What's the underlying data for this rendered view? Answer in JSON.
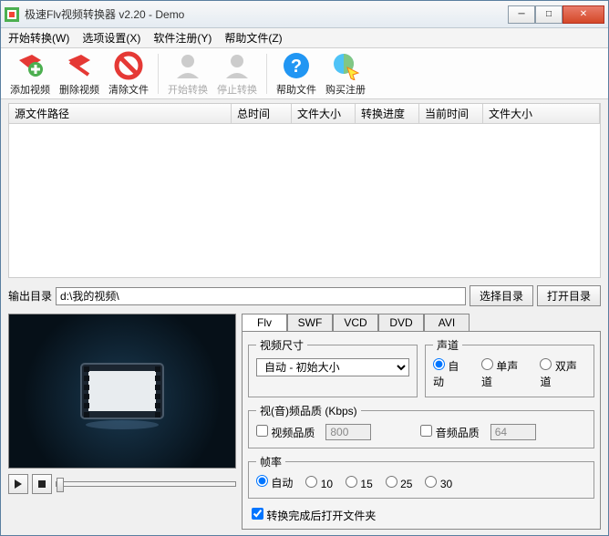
{
  "window": {
    "title": "极速Flv视频转换器 v2.20 - Demo"
  },
  "menu": {
    "start": "开始转换(W)",
    "options": "选项设置(X)",
    "register": "软件注册(Y)",
    "help": "帮助文件(Z)"
  },
  "toolbar": {
    "add": "添加视频",
    "del": "删除视频",
    "clear": "清除文件",
    "begin": "开始转换",
    "stop": "停止转换",
    "help": "帮助文件",
    "buy": "购买注册"
  },
  "columns": {
    "source": "源文件路径",
    "total_time": "总时间",
    "file_size": "文件大小",
    "progress": "转换进度",
    "cur_time": "当前时间",
    "out_size": "文件大小"
  },
  "output": {
    "label": "输出目录",
    "path": "d:\\我的视频\\",
    "browse": "选择目录",
    "open": "打开目录"
  },
  "tabs": {
    "flv": "Flv",
    "swf": "SWF",
    "vcd": "VCD",
    "dvd": "DVD",
    "avi": "AVI"
  },
  "settings": {
    "video_size_legend": "视频尺寸",
    "video_size_val": "自动 - 初始大小",
    "audio_legend": "声道",
    "audio_auto": "自动",
    "audio_mono": "单声道",
    "audio_stereo": "双声道",
    "quality_legend": "视(音)频品质 (Kbps)",
    "video_q_label": "视频品质",
    "video_q_val": "800",
    "audio_q_label": "音频品质",
    "audio_q_val": "64",
    "fps_legend": "帧率",
    "fps_auto": "自动",
    "fps_10": "10",
    "fps_15": "15",
    "fps_25": "25",
    "fps_30": "30",
    "open_after": "转换完成后打开文件夹"
  }
}
